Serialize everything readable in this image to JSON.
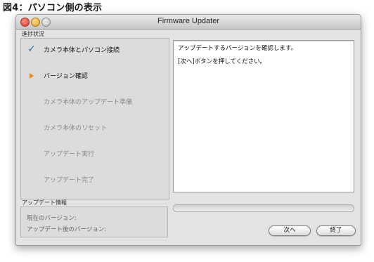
{
  "figure_title": "図4：パソコン側の表示",
  "window": {
    "title": "Firmware Updater"
  },
  "progress_section": {
    "label": "進捗状況",
    "steps": [
      {
        "label": "カメラ本体とパソコン接続",
        "state": "done"
      },
      {
        "label": "バージョン確認",
        "state": "current"
      },
      {
        "label": "カメラ本体のアップデート準備",
        "state": "pending"
      },
      {
        "label": "カメラ本体のリセット",
        "state": "pending"
      },
      {
        "label": "アップデート実行",
        "state": "pending"
      },
      {
        "label": "アップデート完了",
        "state": "pending"
      }
    ]
  },
  "message": {
    "lines": [
      "アップデートするバージョンを確認します。",
      "[次へ]ボタンを押してください。"
    ]
  },
  "progress_bar": {
    "value": 0
  },
  "update_info": {
    "label": "アップデート情報",
    "current_version_label": "現在のバージョン:",
    "after_version_label": "アップデート後のバージョン:"
  },
  "buttons": {
    "next": "次へ",
    "quit": "終了"
  },
  "colors": {
    "check": "#2e6fb5",
    "current_arrow": "#e38a1a",
    "inactive_text": "#8c8c8c"
  }
}
